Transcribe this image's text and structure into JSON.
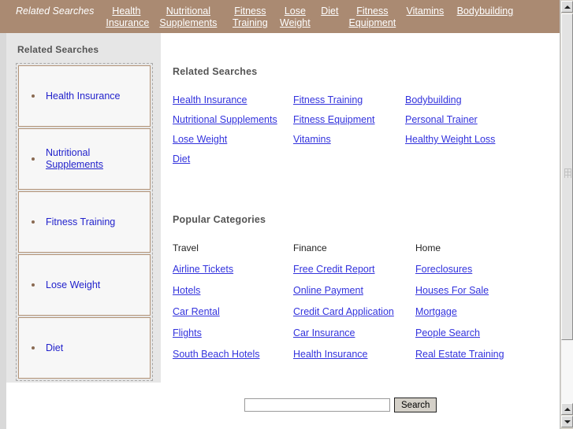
{
  "topnav": {
    "brand": "Related Searches",
    "links": [
      "Health Insurance",
      "Nutritional Supplements",
      "Fitness Training",
      "Lose Weight",
      "Diet",
      "Fitness Equipment",
      "Vitamins",
      "Bodybuilding"
    ],
    "background_color": "#aa8a72",
    "text_color": "#ffffff"
  },
  "sidebar": {
    "title": "Related Searches",
    "items": [
      {
        "label": "Health Insurance"
      },
      {
        "label_part1": "Nutritional",
        "label_part2": "Supplements"
      },
      {
        "label": "Fitness Training"
      },
      {
        "label": "Lose Weight"
      },
      {
        "label": "Diet"
      }
    ],
    "background_color": "#e6e6e6",
    "item_border_color": "#b39478",
    "bullet_color": "#8a6a52",
    "link_color": "#2222cc"
  },
  "main": {
    "related_searches": {
      "title": "Related Searches",
      "links": [
        "Health Insurance",
        "Fitness Training",
        "Bodybuilding",
        "Nutritional Supplements",
        "Fitness Equipment",
        "Personal Trainer",
        "Lose Weight",
        "Vitamins",
        "Healthy Weight Loss",
        "Diet"
      ]
    },
    "popular_categories": {
      "title": "Popular Categories",
      "columns": [
        {
          "heading": "Travel",
          "links": [
            "Airline Tickets",
            "Hotels",
            "Car Rental",
            "Flights",
            "South Beach Hotels"
          ]
        },
        {
          "heading": "Finance",
          "links": [
            "Free Credit Report",
            "Online Payment",
            "Credit Card Application",
            "Car Insurance",
            "Health Insurance"
          ]
        },
        {
          "heading": "Home",
          "links": [
            "Foreclosures",
            "Houses For Sale",
            "Mortgage",
            "People Search",
            "Real Estate Training"
          ]
        }
      ]
    },
    "link_color": "#3333dd",
    "heading_color": "#555555"
  },
  "search": {
    "value": "",
    "placeholder": "",
    "button_label": "Search"
  },
  "scrollbar": {
    "up_icon": "triangle-up-icon",
    "down_icon": "triangle-down-icon"
  }
}
